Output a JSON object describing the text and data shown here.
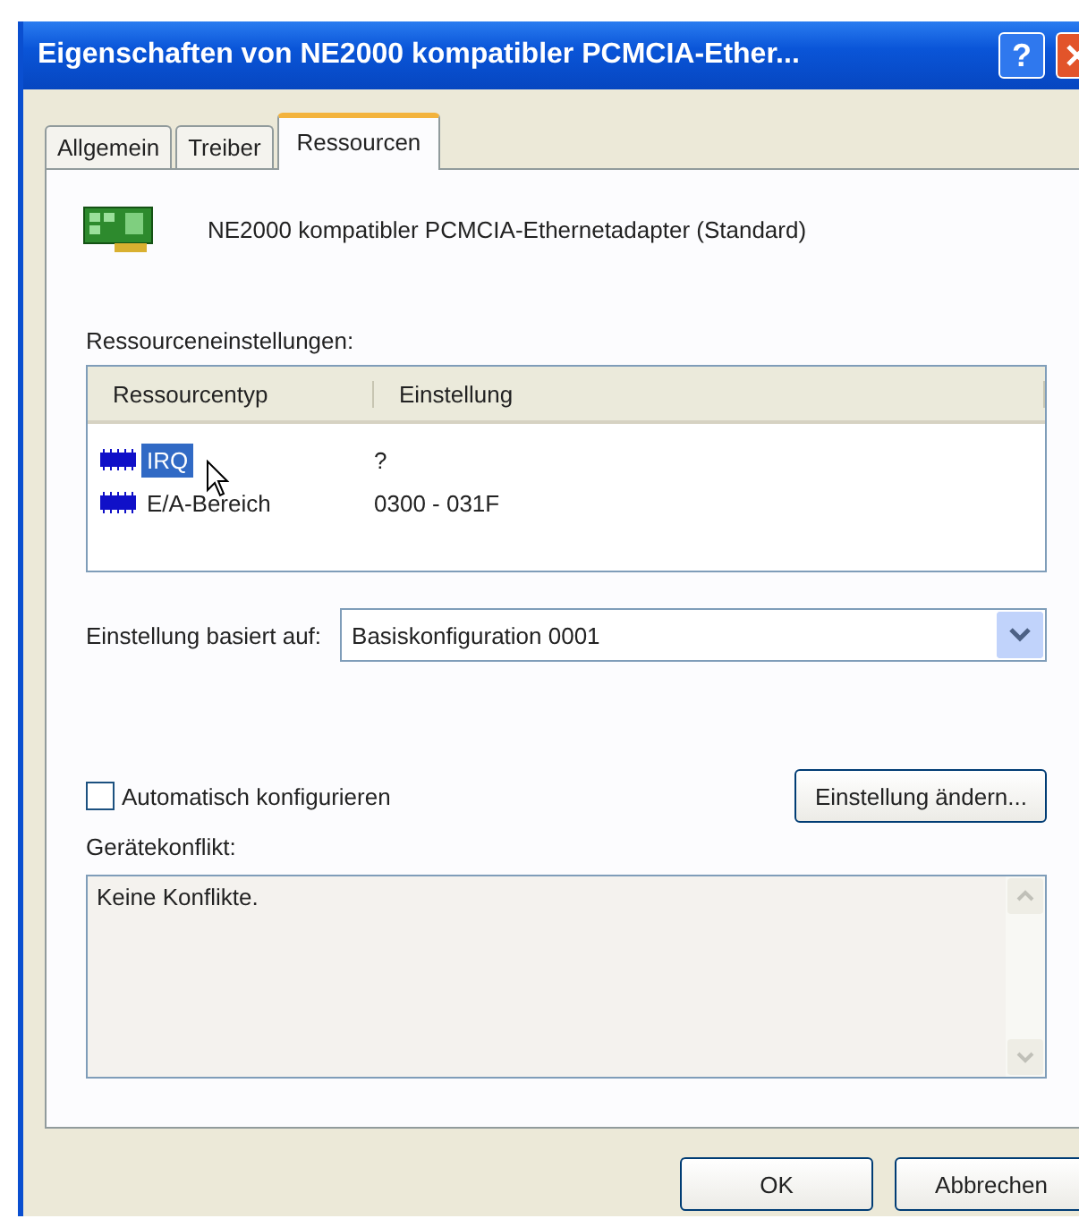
{
  "window": {
    "title": "Eigenschaften von NE2000 kompatibler PCMCIA-Ether...",
    "help_button": "?"
  },
  "tabs": [
    {
      "label": "Allgemein",
      "selected": false
    },
    {
      "label": "Treiber",
      "selected": false
    },
    {
      "label": "Ressourcen",
      "selected": true
    }
  ],
  "device_name": "NE2000 kompatibler PCMCIA-Ethernetadapter (Standard)",
  "resource_settings": {
    "label": "Ressourceneinstellungen:",
    "columns": [
      "Ressourcentyp",
      "Einstellung"
    ],
    "rows": [
      {
        "type": "IRQ",
        "setting": "?",
        "selected": true
      },
      {
        "type": "E/A-Bereich",
        "setting": "0300 - 031F",
        "selected": false
      }
    ]
  },
  "based_on": {
    "label": "Einstellung basiert auf:",
    "value": "Basiskonfiguration 0001"
  },
  "auto_configure": {
    "label": "Automatisch konfigurieren",
    "checked": false
  },
  "change_button": "Einstellung ändern...",
  "conflict": {
    "label": "Gerätekonflikt:",
    "text": "Keine Konflikte."
  },
  "buttons": [
    "OK",
    "Abbrechen"
  ]
}
